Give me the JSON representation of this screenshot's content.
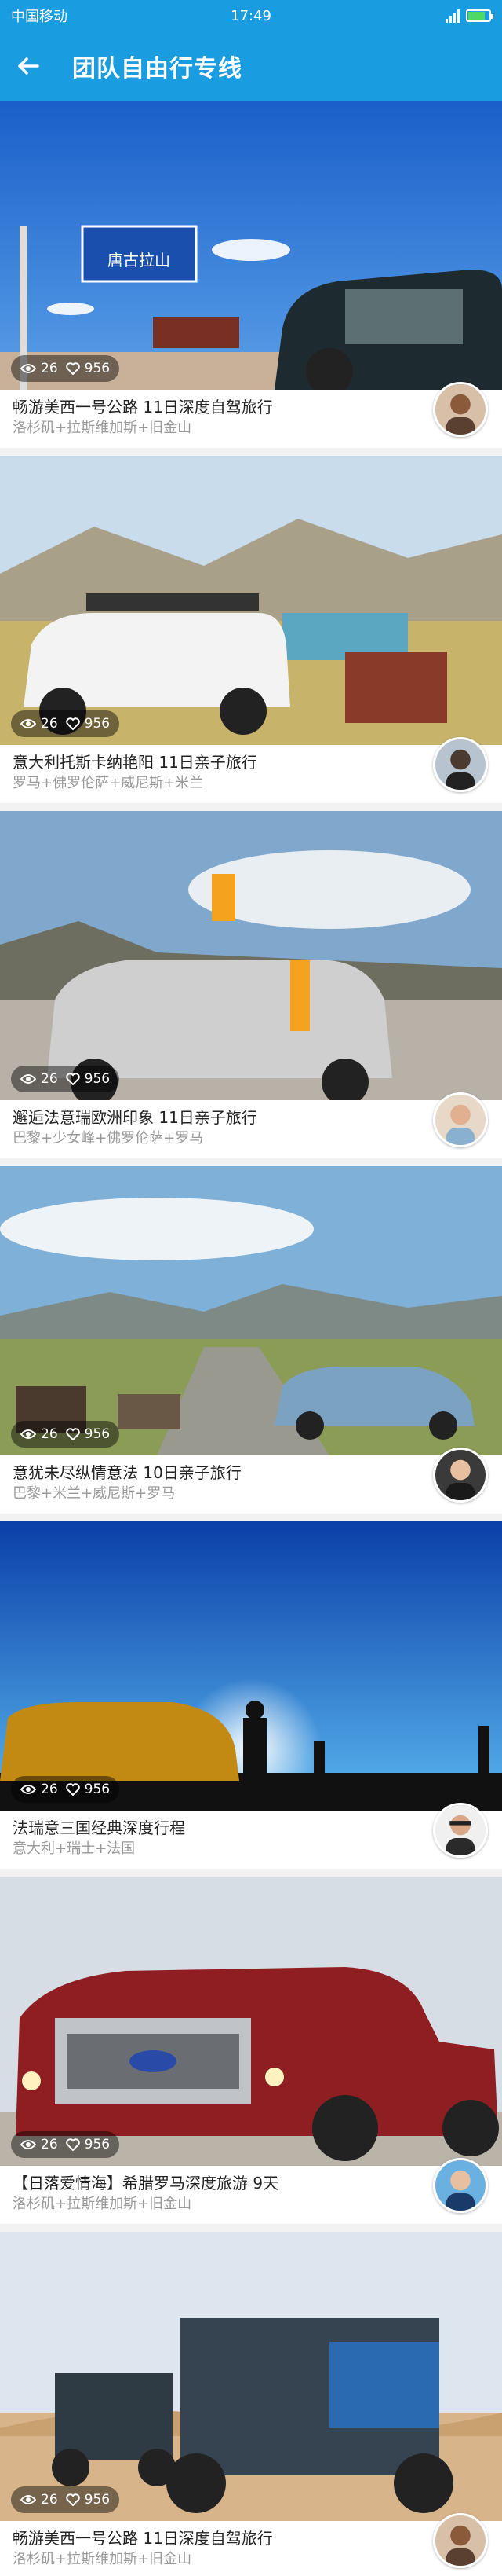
{
  "status": {
    "carrier": "中国移动",
    "time": "17:49"
  },
  "header": {
    "title": "团队自由行专线"
  },
  "colors": {
    "primary": "#1a9ce0",
    "battery": "#4cd964"
  },
  "icons": {
    "back": "arrow-left-icon",
    "views": "eye-icon",
    "likes": "heart-icon"
  },
  "trips": [
    {
      "title": "畅游美西一号公路 11日深度自驾旅行",
      "route": "洛杉矶+拉斯维加斯+旧金山",
      "views": "26",
      "likes": "956",
      "sign_text": "唐古拉山"
    },
    {
      "title": "意大利托斯卡纳艳阳 11日亲子旅行",
      "route": "罗马+佛罗伦萨+威尼斯+米兰",
      "views": "26",
      "likes": "956"
    },
    {
      "title": "邂逅法意瑞欧洲印象 11日亲子旅行",
      "route": "巴黎+少女峰+佛罗伦萨+罗马",
      "views": "26",
      "likes": "956"
    },
    {
      "title": "意犹未尽纵情意法 10日亲子旅行",
      "route": "巴黎+米兰+威尼斯+罗马",
      "views": "26",
      "likes": "956"
    },
    {
      "title": "法瑞意三国经典深度行程",
      "route": "意大利+瑞士+法国",
      "views": "26",
      "likes": "956"
    },
    {
      "title": "【日落爱情海】希腊罗马深度旅游 9天",
      "route": "洛杉矶+拉斯维加斯+旧金山",
      "views": "26",
      "likes": "956"
    },
    {
      "title": "畅游美西一号公路 11日深度自驾旅行",
      "route": "洛杉矶+拉斯维加斯+旧金山",
      "views": "26",
      "likes": "956"
    }
  ]
}
